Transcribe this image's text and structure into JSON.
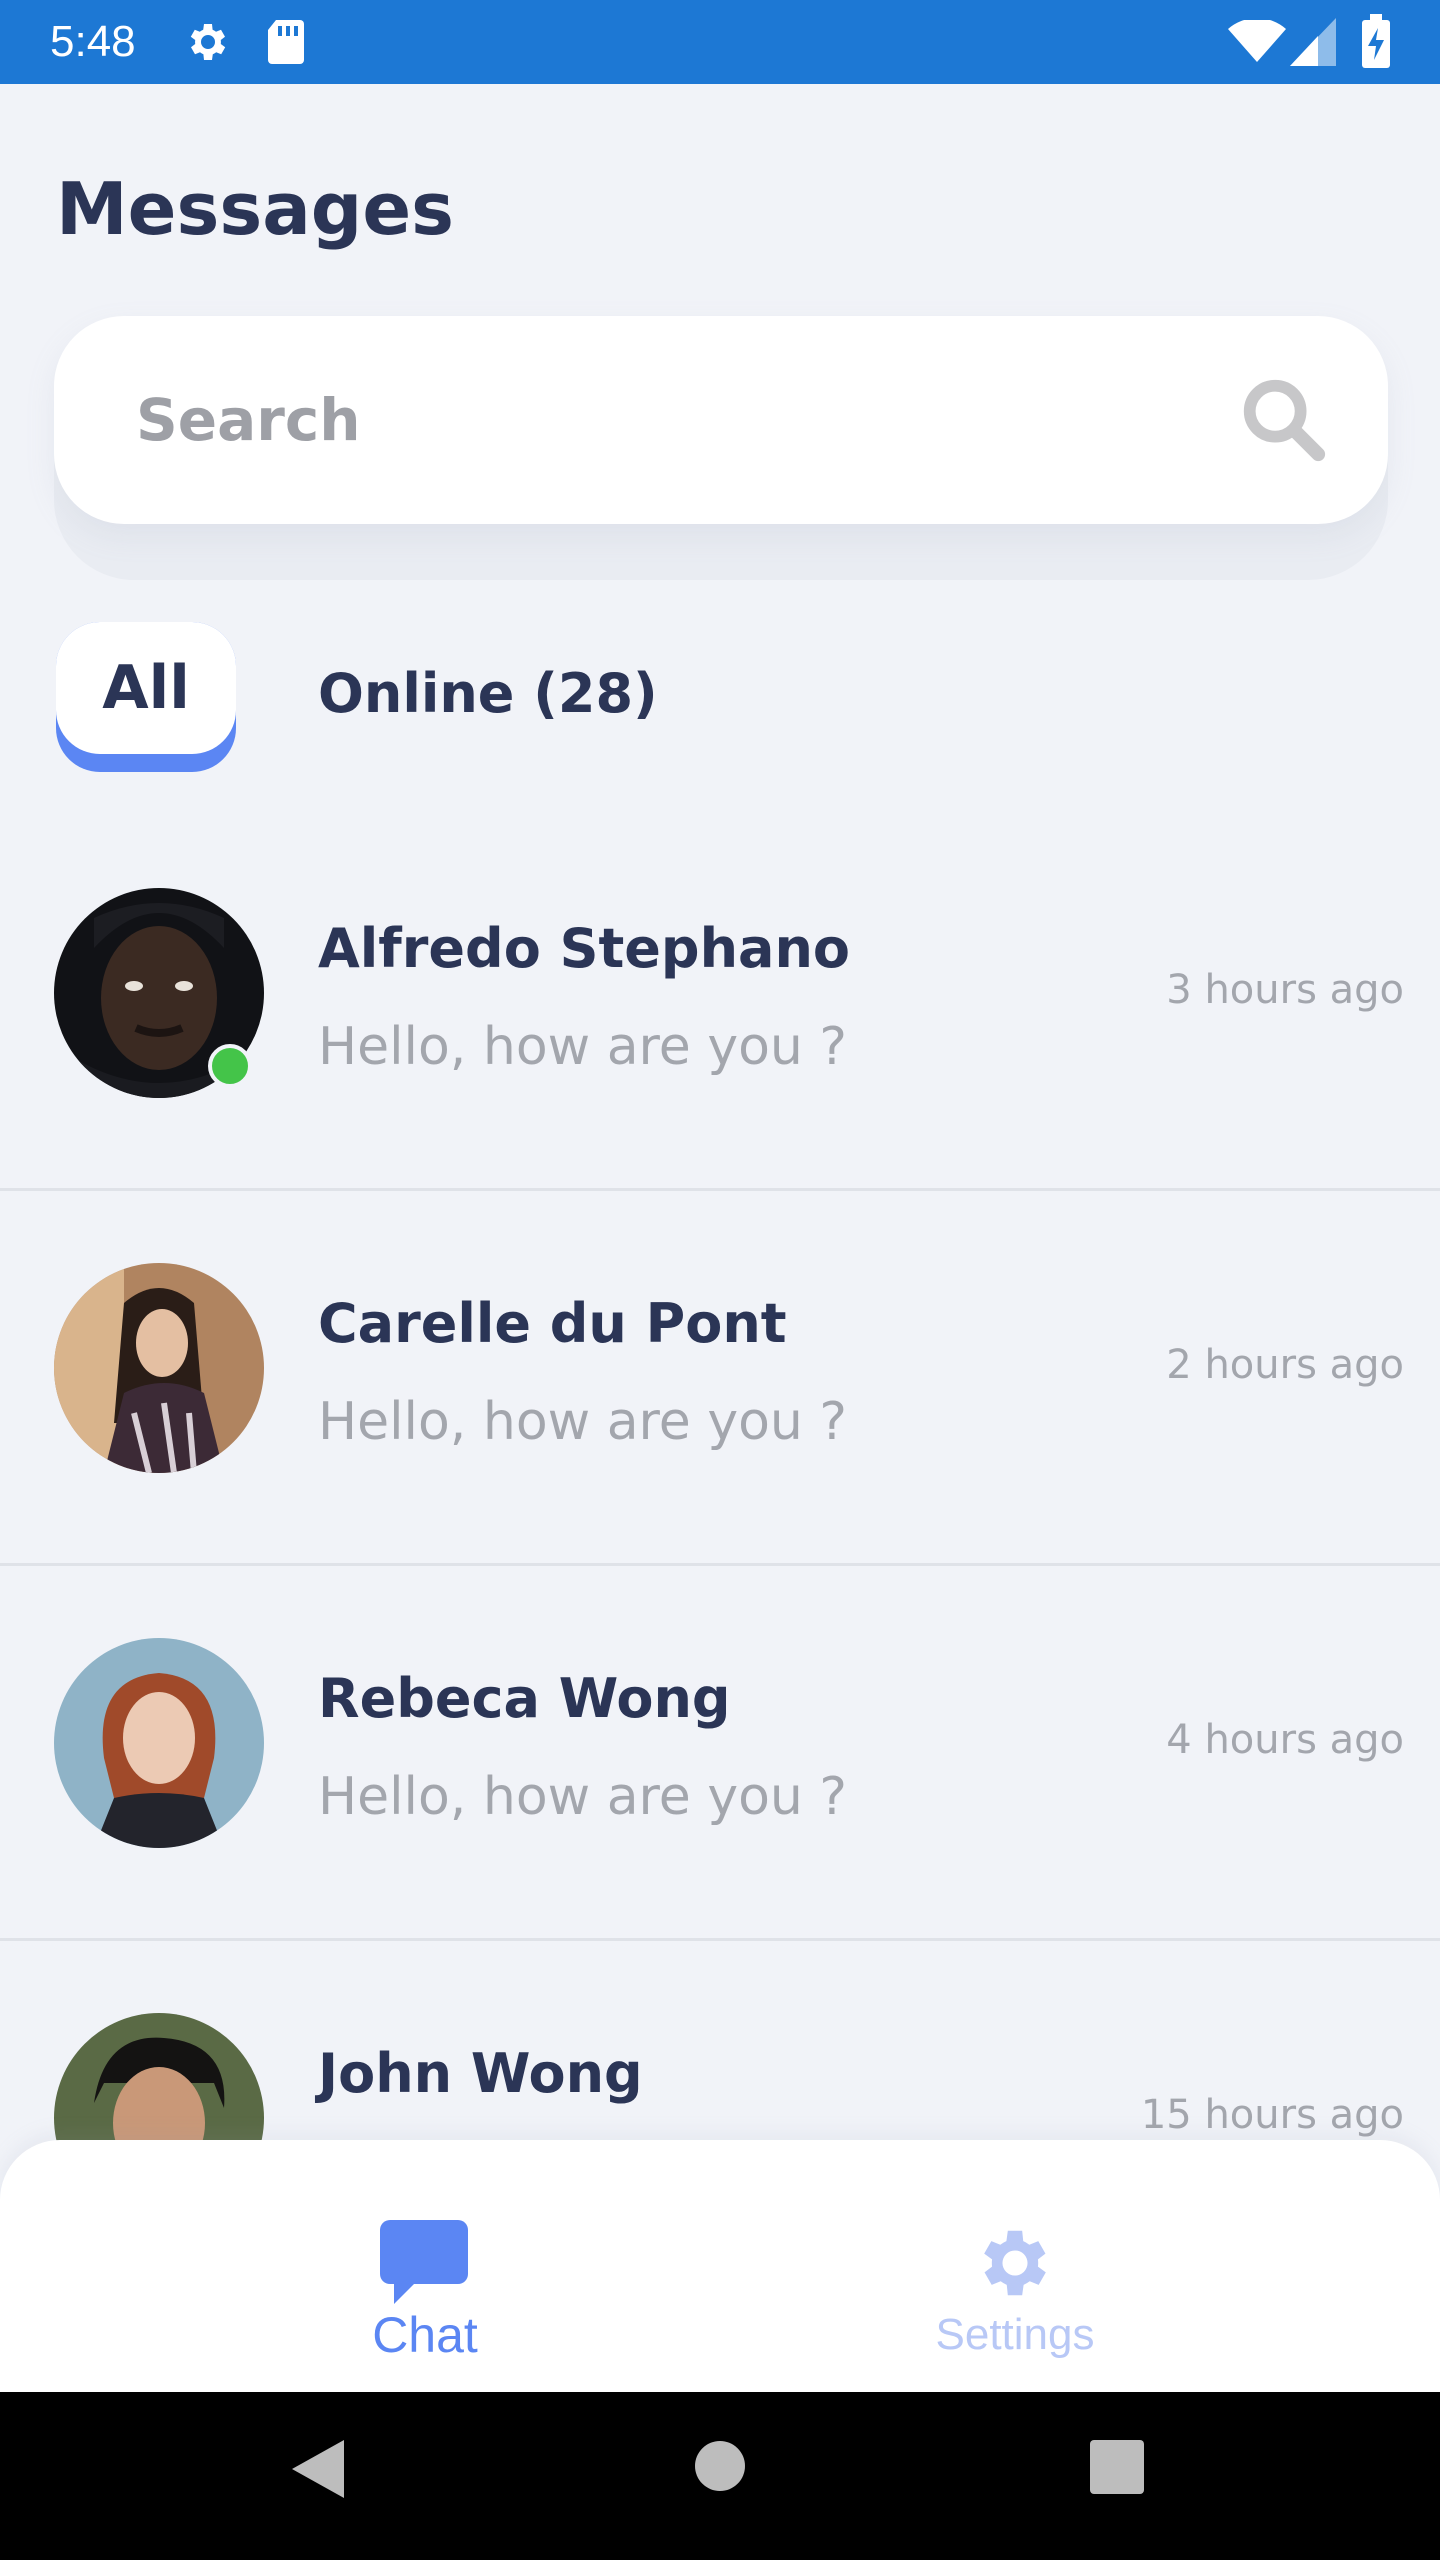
{
  "status_bar": {
    "time": "5:48",
    "background": "#1d78d4",
    "icons": [
      "gear-icon",
      "sd-card-icon",
      "wifi-icon",
      "signal-icon",
      "battery-charging-icon"
    ]
  },
  "header": {
    "title": "Messages"
  },
  "search": {
    "placeholder": "Search",
    "value": "",
    "icon": "search-icon"
  },
  "filters": {
    "all_label": "All",
    "online_label": "Online (28)",
    "active": "All",
    "accent": "#5b86f3"
  },
  "messages": [
    {
      "name": "Alfredo Stephano",
      "preview": "Hello, how are you ?",
      "time": "3 hours ago",
      "online": true
    },
    {
      "name": "Carelle du Pont",
      "preview": "Hello, how are you ?",
      "time": "2 hours ago",
      "online": false
    },
    {
      "name": "Rebeca Wong",
      "preview": "Hello, how are you ?",
      "time": "4 hours ago",
      "online": false
    },
    {
      "name": "John Wong",
      "preview": "",
      "time": "15 hours ago",
      "online": false
    }
  ],
  "bottom_nav": {
    "chat_label": "Chat",
    "settings_label": "Settings",
    "active": "Chat",
    "active_color": "#5b86f3",
    "inactive_color": "#b8c8f6"
  },
  "system_nav": {
    "icons": [
      "back-icon",
      "home-icon",
      "recents-icon"
    ]
  }
}
